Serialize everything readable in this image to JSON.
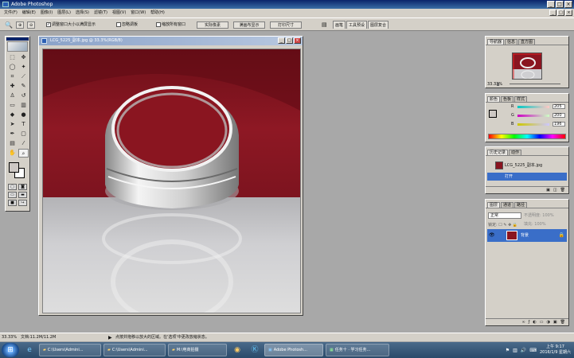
{
  "app": {
    "title": "Adobe Photoshop",
    "window_controls": [
      "_",
      "□",
      "×"
    ]
  },
  "menu": {
    "items": [
      "文件(F)",
      "编辑(E)",
      "图像(I)",
      "图层(L)",
      "选择(S)",
      "滤镜(T)",
      "视图(V)",
      "窗口(W)",
      "帮助(H)"
    ],
    "doc_controls": [
      "_",
      "□",
      "×"
    ]
  },
  "options": {
    "zoom_tool_icon": "zoom-icon",
    "resize_windows": "调整窗口大小以满屏显示",
    "ignore_palettes": "忽略调板",
    "zoom_all_windows": "缩放所有窗口",
    "actual_pixels": "实际像素",
    "fit_on_screen": "满画布显示",
    "print_size": "打印尺寸",
    "palette_well": [
      "画笔",
      "工具预设",
      "图层复合"
    ]
  },
  "document": {
    "title": "LCG_5225_副本.jpg @ 33.3%(RGB/8)",
    "controls": [
      "_",
      "□",
      "×"
    ],
    "colors": {
      "backdrop": "#8a1520",
      "surface": "#c9c7c7"
    }
  },
  "navigator": {
    "tabs": [
      "导航器",
      "信息",
      "直方图"
    ],
    "zoom": "33.33%"
  },
  "color_panel": {
    "tabs": [
      "颜色",
      "色板",
      "样式"
    ],
    "r_label": "R",
    "r_value": "205",
    "g_label": "G",
    "g_value": "200",
    "b_label": "B",
    "b_value": "196",
    "swatch": "#cdc8c4"
  },
  "history": {
    "tabs": [
      "历史记录",
      "动作"
    ],
    "snapshot": "LCG_5225_副本.jpg",
    "step": "打开"
  },
  "layers": {
    "tabs": [
      "图层",
      "通道",
      "路径"
    ],
    "mode": "正常",
    "opacity": "不透明度: 100%",
    "lock": "锁定: ☐ ✎ ✥ 🔒",
    "fill": "填充: 100%",
    "layer_name": "背景"
  },
  "status": {
    "zoom": "33.33%",
    "doc_size": "文档:11.2M/11.2M",
    "hint": "点按并拖移以放大的区域。在'选项'中更改放缩状态。"
  },
  "taskbar": {
    "buttons": [
      "C:\\Users\\Admini...",
      "C:\\Users\\Admini...",
      "M:\\电商拍摄",
      "Adobe Photosh...",
      "任务十 · 学习任务..."
    ],
    "clock_time": "上午 9:17",
    "clock_date": "2016/1/9 星期六"
  }
}
